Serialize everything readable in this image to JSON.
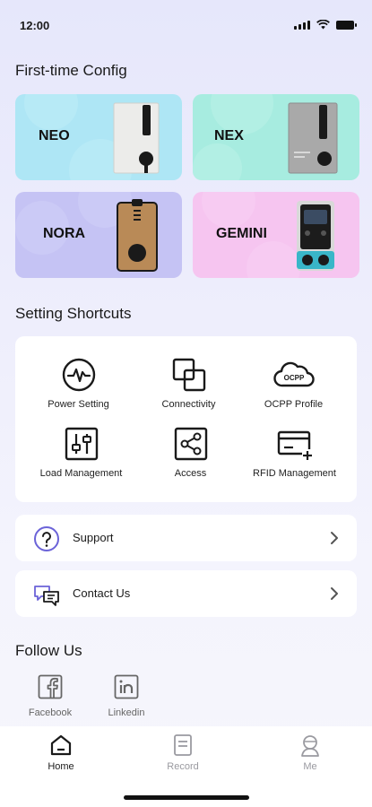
{
  "status_bar": {
    "time": "12:00"
  },
  "first_time_config": {
    "title": "First-time Config",
    "models": [
      {
        "name": "NEO"
      },
      {
        "name": "NEX"
      },
      {
        "name": "NORA"
      },
      {
        "name": "GEMINI"
      }
    ]
  },
  "setting_shortcuts": {
    "title": "Setting Shortcuts",
    "items": [
      {
        "label": "Power Setting",
        "icon": "power-pulse-icon"
      },
      {
        "label": "Connectivity",
        "icon": "connectivity-icon"
      },
      {
        "label": "OCPP Profile",
        "icon": "ocpp-cloud-icon",
        "icon_text": "OCPP"
      },
      {
        "label": "Load Management",
        "icon": "sliders-icon"
      },
      {
        "label": "Access",
        "icon": "share-icon"
      },
      {
        "label": "RFID Management",
        "icon": "card-plus-icon"
      }
    ]
  },
  "links": {
    "support": "Support",
    "contact_us": "Contact Us"
  },
  "follow_us": {
    "title": "Follow Us",
    "items": [
      {
        "label": "Facebook",
        "icon": "facebook-icon"
      },
      {
        "label": "Linkedin",
        "icon": "linkedin-icon"
      }
    ]
  },
  "bottom_nav": {
    "items": [
      {
        "label": "Home",
        "active": true
      },
      {
        "label": "Record",
        "active": false
      },
      {
        "label": "Me",
        "active": false
      }
    ]
  },
  "colors": {
    "neo": "#aee6f5",
    "nex": "#a7ece0",
    "nora": "#c5c3f4",
    "gemini": "#f6c5f0",
    "support_icon": "#6b63d8",
    "inactive_nav": "#9a9aa0"
  }
}
